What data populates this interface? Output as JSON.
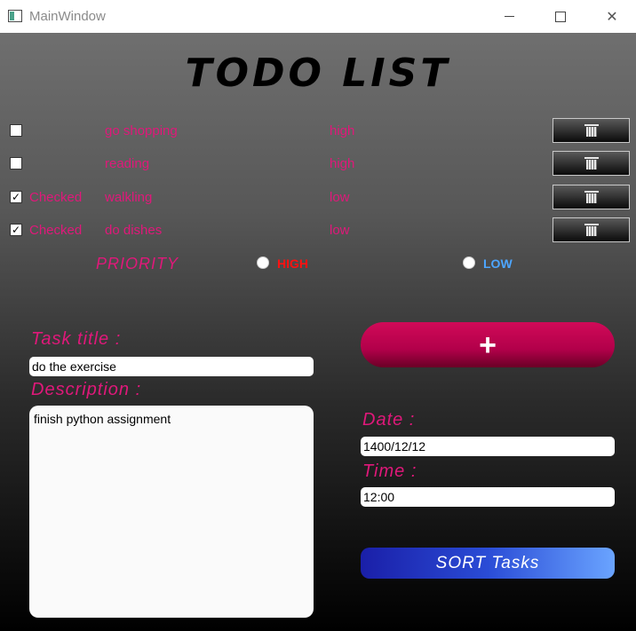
{
  "window": {
    "title": "MainWindow"
  },
  "header": {
    "title": "TODO LIST"
  },
  "tasks": [
    {
      "checked": false,
      "checked_label": "",
      "title": "go shopping",
      "priority": "high"
    },
    {
      "checked": false,
      "checked_label": "",
      "title": "reading",
      "priority": "high"
    },
    {
      "checked": true,
      "checked_label": "Checked",
      "title": "walkling",
      "priority": "low"
    },
    {
      "checked": true,
      "checked_label": "Checked",
      "title": "do dishes",
      "priority": "low"
    }
  ],
  "priority": {
    "label": "PRIORITY",
    "high_label": "HIGH",
    "low_label": "LOW"
  },
  "form": {
    "task_title_label": "Task title :",
    "task_title_value": "do the exercise",
    "description_label": "Description :",
    "description_value": "finish python assignment",
    "date_label": "Date :",
    "date_value": "1400/12/12",
    "time_label": "Time :",
    "time_value": "12:00",
    "add_label": "+",
    "sort_label": "SORT Tasks"
  },
  "icons": {
    "delete": "trash-icon",
    "checkbox_checked": "checkmark-icon"
  },
  "colors": {
    "accent_pink": "#e0187a",
    "high_red": "#ff1111",
    "low_blue": "#4da6ff",
    "add_button": "#b2004a",
    "sort_button": "#2a4cd6"
  }
}
